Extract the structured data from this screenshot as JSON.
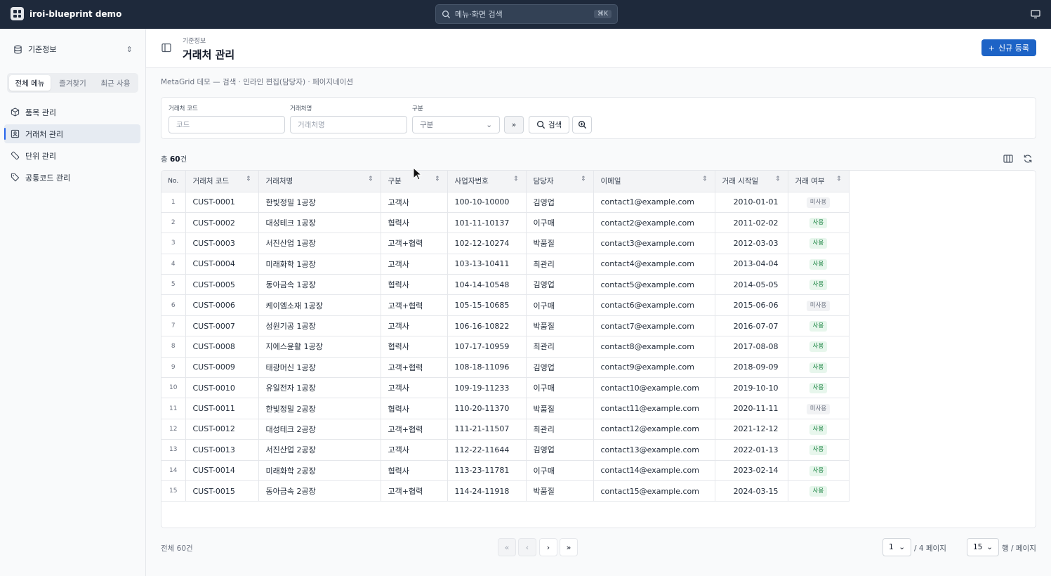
{
  "app": {
    "name": "iroi-blueprint demo"
  },
  "top_search": {
    "placeholder": "메뉴·화면 검색",
    "shortcut": "⌘K"
  },
  "sidebar": {
    "group_label": "기준정보",
    "tabs": [
      {
        "label": "전체 메뉴",
        "active": true
      },
      {
        "label": "즐겨찾기"
      },
      {
        "label": "최근 사용"
      }
    ],
    "items": [
      {
        "label": "품목 관리",
        "icon": "cube-icon"
      },
      {
        "label": "거래처 관리",
        "icon": "contact-card-icon",
        "active": true
      },
      {
        "label": "단위 관리",
        "icon": "ruler-icon"
      },
      {
        "label": "공통코드 관리",
        "icon": "tag-icon"
      }
    ]
  },
  "header": {
    "breadcrumb": "기준정보",
    "title": "거래처 관리",
    "new_button": "신규 등록"
  },
  "description": "MetaGrid 데모 — 검색 · 인라인 편집(담당자) · 페이지네이션",
  "filters": {
    "code": {
      "label": "거래처 코드",
      "placeholder": "코드"
    },
    "name": {
      "label": "거래처명",
      "placeholder": "거래처명"
    },
    "type": {
      "label": "구분",
      "value": "구분"
    },
    "search_button": "검색"
  },
  "summary": {
    "prefix": "총 ",
    "count": "60",
    "suffix": "건"
  },
  "table": {
    "columns": [
      "No.",
      "거래처 코드",
      "거래처명",
      "구분",
      "사업자번호",
      "담당자",
      "이메일",
      "거래 시작일",
      "거래 여부"
    ],
    "rows": [
      [
        "1",
        "CUST-0001",
        "한빛정밀 1공장",
        "고객사",
        "100-10-10000",
        "김영업",
        "contact1@example.com",
        "2010-01-01",
        "미사용"
      ],
      [
        "2",
        "CUST-0002",
        "대성테크 1공장",
        "협력사",
        "101-11-10137",
        "이구매",
        "contact2@example.com",
        "2011-02-02",
        "사용"
      ],
      [
        "3",
        "CUST-0003",
        "서진산업 1공장",
        "고객+협력",
        "102-12-10274",
        "박품질",
        "contact3@example.com",
        "2012-03-03",
        "사용"
      ],
      [
        "4",
        "CUST-0004",
        "미래화학 1공장",
        "고객사",
        "103-13-10411",
        "최관리",
        "contact4@example.com",
        "2013-04-04",
        "사용"
      ],
      [
        "5",
        "CUST-0005",
        "동아금속 1공장",
        "협력사",
        "104-14-10548",
        "김영업",
        "contact5@example.com",
        "2014-05-05",
        "사용"
      ],
      [
        "6",
        "CUST-0006",
        "케이엠소재 1공장",
        "고객+협력",
        "105-15-10685",
        "이구매",
        "contact6@example.com",
        "2015-06-06",
        "미사용"
      ],
      [
        "7",
        "CUST-0007",
        "성원기공 1공장",
        "고객사",
        "106-16-10822",
        "박품질",
        "contact7@example.com",
        "2016-07-07",
        "사용"
      ],
      [
        "8",
        "CUST-0008",
        "지에스윤활 1공장",
        "협력사",
        "107-17-10959",
        "최관리",
        "contact8@example.com",
        "2017-08-08",
        "사용"
      ],
      [
        "9",
        "CUST-0009",
        "태광머신 1공장",
        "고객+협력",
        "108-18-11096",
        "김영업",
        "contact9@example.com",
        "2018-09-09",
        "사용"
      ],
      [
        "10",
        "CUST-0010",
        "유일전자 1공장",
        "고객사",
        "109-19-11233",
        "이구매",
        "contact10@example.com",
        "2019-10-10",
        "사용"
      ],
      [
        "11",
        "CUST-0011",
        "한빛정밀 2공장",
        "협력사",
        "110-20-11370",
        "박품질",
        "contact11@example.com",
        "2020-11-11",
        "미사용"
      ],
      [
        "12",
        "CUST-0012",
        "대성테크 2공장",
        "고객+협력",
        "111-21-11507",
        "최관리",
        "contact12@example.com",
        "2021-12-12",
        "사용"
      ],
      [
        "13",
        "CUST-0013",
        "서진산업 2공장",
        "고객사",
        "112-22-11644",
        "김영업",
        "contact13@example.com",
        "2022-01-13",
        "사용"
      ],
      [
        "14",
        "CUST-0014",
        "미래화학 2공장",
        "협력사",
        "113-23-11781",
        "이구매",
        "contact14@example.com",
        "2023-02-14",
        "사용"
      ],
      [
        "15",
        "CUST-0015",
        "동아금속 2공장",
        "고객+협력",
        "114-24-11918",
        "박품질",
        "contact15@example.com",
        "2024-03-15",
        "사용"
      ]
    ]
  },
  "footer": {
    "total": "전체 60건",
    "page": "1",
    "page_suffix": "/ 4 페이지",
    "page_size": "15",
    "page_size_suffix": "행 / 페이지"
  },
  "colors": {
    "topbar": "#1e293b",
    "primary": "#1d63c6",
    "active_badge": "#15803d"
  }
}
